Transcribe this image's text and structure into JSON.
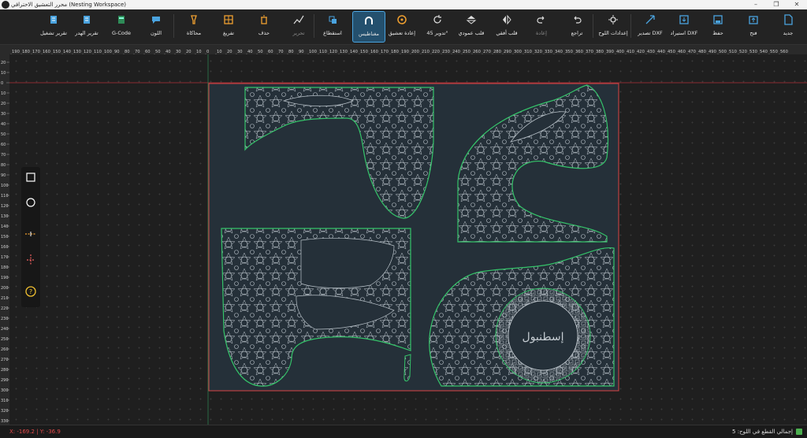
{
  "window": {
    "title": "محرر التعشيق الاحترافي (Nesting Workspace)"
  },
  "toolbar": {
    "new": "جديد",
    "open": "فتح",
    "save": "حفظ",
    "import_dxf": "استيراد DXF",
    "export_dxf": "تصدير DXF",
    "plate_settings": "إعدادات اللوح",
    "undo": "تراجع",
    "redo": "إعادة",
    "flip_h": "قلب أفقي",
    "flip_v": "قلب عمودي",
    "rotate45": "تدوير 45°",
    "renest": "إعادة تعشيق",
    "magnet": "مغناطيس",
    "align": "استقطاع",
    "edit": "تحرير",
    "delete": "حذف",
    "cut": "تفريغ",
    "simulate": "محاكاة",
    "color": "اللون",
    "gcode": "G-Code",
    "waste_report": "تقرير الهدر",
    "run_report": "تقرير تشغيل"
  },
  "rulers": {
    "top": [
      "190",
      "180",
      "170",
      "160",
      "150",
      "140",
      "130",
      "120",
      "110",
      "100",
      "90",
      "80",
      "70",
      "60",
      "50",
      "40",
      "30",
      "20",
      "10",
      "0",
      "10",
      "20",
      "30",
      "40",
      "50",
      "60",
      "70",
      "80",
      "90",
      "100",
      "110",
      "120",
      "130",
      "140",
      "150",
      "160",
      "170",
      "180",
      "190",
      "200",
      "210",
      "220",
      "230",
      "240",
      "250",
      "260",
      "270",
      "280",
      "290",
      "300",
      "310",
      "320",
      "330",
      "340",
      "350",
      "360",
      "370",
      "380",
      "390",
      "400",
      "410",
      "420",
      "430",
      "440",
      "450",
      "460",
      "470",
      "480",
      "490",
      "500",
      "510",
      "520",
      "530",
      "540",
      "550",
      "560"
    ],
    "left": [
      "20",
      "10",
      "0",
      "10",
      "20",
      "30",
      "40",
      "50",
      "60",
      "70",
      "80",
      "90",
      "100",
      "110",
      "120",
      "130",
      "140",
      "150",
      "160",
      "170",
      "180",
      "190",
      "200",
      "210",
      "220",
      "230",
      "240",
      "250",
      "260",
      "270",
      "280",
      "290",
      "300",
      "310",
      "320",
      "330"
    ]
  },
  "status": {
    "coords": "X: -169.2 | Y: -36.9",
    "total": "إجمالي القطع في اللوح: 5"
  },
  "canvas": {
    "calligraphy": "إسطنبول",
    "part_color": "#35c46a",
    "plate_color": "#d94545"
  },
  "tools": [
    "rect-tool",
    "circle-tool",
    "dash-line-tool",
    "crosshair-tool",
    "help-tool"
  ]
}
